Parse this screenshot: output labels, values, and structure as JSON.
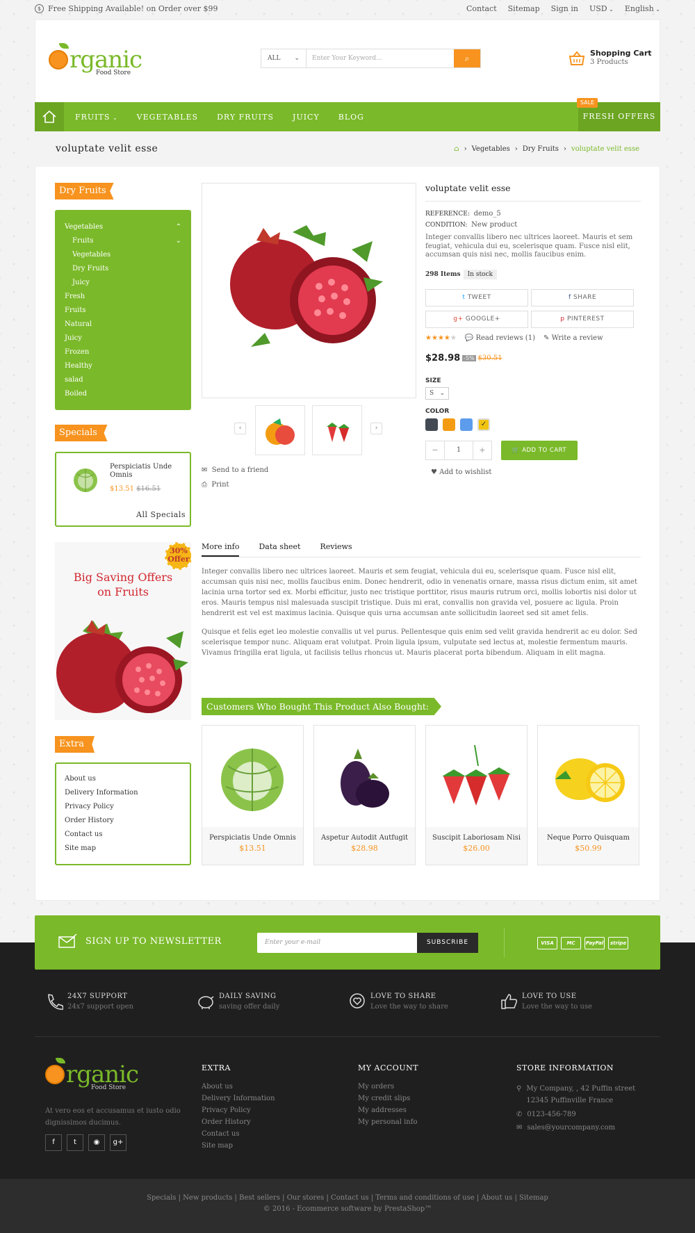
{
  "topbar": {
    "shipping_icon": "dollar-coin-icon",
    "shipping": "Free Shipping Available! on Order over $99",
    "links": [
      "Contact",
      "Sitemap",
      "Sign in",
      "USD",
      "English"
    ]
  },
  "logo": {
    "word": "rganic",
    "sub": "Food Store"
  },
  "search": {
    "category": "ALL",
    "placeholder": "Enter Your Keyword..."
  },
  "cart": {
    "title": "Shopping Cart",
    "count": "3 Products"
  },
  "nav": {
    "items": [
      "FRUITS",
      "VEGETABLES",
      "DRY FRUITS",
      "JUICY",
      "BLOG"
    ],
    "offers": "FRESH OFFERS",
    "sale_badge": "SALE"
  },
  "page": {
    "title": "voluptate velit esse",
    "breadcrumbs": [
      "Vegetables",
      "Dry Fruits",
      "voluptate velit esse"
    ]
  },
  "sidebar": {
    "categories_title": "Dry Fruits",
    "categories": [
      "Vegetables",
      "Fruits",
      "Vegetables",
      "Dry Fruits",
      "Juicy",
      "Fresh",
      "Fruits",
      "Natural",
      "Juicy",
      "Frozen",
      "Healthy",
      "salad",
      "Boiled"
    ],
    "specials_title": "Specials",
    "special_item": {
      "name": "Perspiciatis Unde Omnis",
      "price": "$13.51",
      "old_price": "$16.51"
    },
    "all_specials": "All Specials",
    "banner": {
      "badge1": "30%",
      "badge2": "Offer",
      "line1": "Big Saving Offers",
      "line2": "on Fruits"
    },
    "extra_title": "Extra",
    "extra_links": [
      "About us",
      "Delivery Information",
      "Privacy Policy",
      "Order History",
      "Contact us",
      "Site map"
    ]
  },
  "product": {
    "name": "voluptate velit esse",
    "reference_label": "REFERENCE:",
    "reference": "demo_5",
    "condition_label": "CONDITION:",
    "condition": "New product",
    "short_desc": "Integer convallis libero nec ultrices laoreet. Mauris et sem feugiat, vehicula dui eu, scelerisque quam. Fusce nisl elit, accumsan quis nisi nec, mollis faucibus enim.",
    "items": "298 Items",
    "stock": "In stock",
    "share": [
      "TWEET",
      "SHARE",
      "GOOGLE+",
      "PINTEREST"
    ],
    "rating": 4,
    "read_reviews": "Read reviews (1)",
    "write_review": "Write a review",
    "price": "$28.98",
    "discount": "-5%",
    "old_price": "$30.51",
    "size_label": "SIZE",
    "size_value": "S",
    "color_label": "COLOR",
    "colors": [
      "#434a54",
      "#f39c11",
      "#5d9cec",
      "#f1c40f"
    ],
    "qty": "1",
    "add_to_cart": "ADD TO CART",
    "wishlist": "Add to wishlist",
    "send_friend": "Send to a friend",
    "print": "Print"
  },
  "tabs": [
    "More info",
    "Data sheet",
    "Reviews"
  ],
  "description": [
    "Integer convallis libero nec ultrices laoreet. Mauris et sem feugiat, vehicula dui eu, scelerisque quam. Fusce nisl elit, accumsan quis nisi nec, mollis faucibus enim. Donec hendrerit, odio in venenatis ornare, massa risus dictum enim, sit amet lacinia urna tortor sed ex. Morbi efficitur, justo nec tristique porttitor, risus mauris rutrum orci, mollis lobortis nisi dolor ut eros. Mauris tempus nisl malesuada suscipit tristique. Duis mi erat, convallis non gravida vel, posuere ac ligula. Proin hendrerit est vel est maximus lacinia. Quisque quis urna accumsan ante sollicitudin laoreet sed sit amet felis.",
    "Quisque et felis eget leo molestie convallis ut vel purus. Pellentesque quis enim sed velit gravida hendrerit ac eu dolor. Sed scelerisque tempor nunc. Aliquam erat volutpat. Proin ligula ipsum, vulputate sed lectus at, molestie fermentum mauris. Vivamus fringilla erat ligula, ut facilisis tellus rhoncus ut. Mauris placerat porta bibendum. Aliquam in elit magna."
  ],
  "related": {
    "title": "Customers Who Bought This Product Also Bought:",
    "products": [
      {
        "name": "Perspiciatis Unde Omnis",
        "price": "$13.51"
      },
      {
        "name": "Aspetur Autodit Autfugit",
        "price": "$28.98"
      },
      {
        "name": "Suscipit Laboriosam Nisi",
        "price": "$26.00"
      },
      {
        "name": "Neque Porro Quisquam",
        "price": "$50.99"
      }
    ]
  },
  "newsletter": {
    "title": "SIGN UP TO NEWSLETTER",
    "placeholder": "Enter your e-mail",
    "button": "SUBSCRIBE",
    "cards": [
      "VISA",
      "MC",
      "PayPal",
      "stripe"
    ]
  },
  "features": [
    {
      "title": "24X7 SUPPORT",
      "sub": "24x7 support open"
    },
    {
      "title": "DAILY SAVING",
      "sub": "saving offer daily"
    },
    {
      "title": "LOVE TO SHARE",
      "sub": "Love the way to share"
    },
    {
      "title": "LOVE TO USE",
      "sub": "Love the way to use"
    }
  ],
  "footer": {
    "about": "At vero eos et accusamus et iusto odio dignissimos ducimus.",
    "extra_title": "EXTRA",
    "extra_links": [
      "About us",
      "Delivery Information",
      "Privacy Policy",
      "Order History",
      "Contact us",
      "Site map"
    ],
    "account_title": "MY ACCOUNT",
    "account_links": [
      "My orders",
      "My credit slips",
      "My addresses",
      "My personal info"
    ],
    "store_title": "STORE INFORMATION",
    "store_address": "My Company, , 42 Puffin street 12345 Puffinville France",
    "store_phone": "0123-456-789",
    "store_email": "sales@yourcompany.com",
    "bottom_links": [
      "Specials",
      "New products",
      "Best sellers",
      "Our stores",
      "Contact us",
      "Terms and conditions of use",
      "About us",
      "Sitemap"
    ],
    "copyright": "© 2016 - Ecommerce software by PrestaShop™"
  },
  "colors": {
    "green": "#7ab929",
    "orange": "#f7931e",
    "dark": "#1f1f1f"
  }
}
